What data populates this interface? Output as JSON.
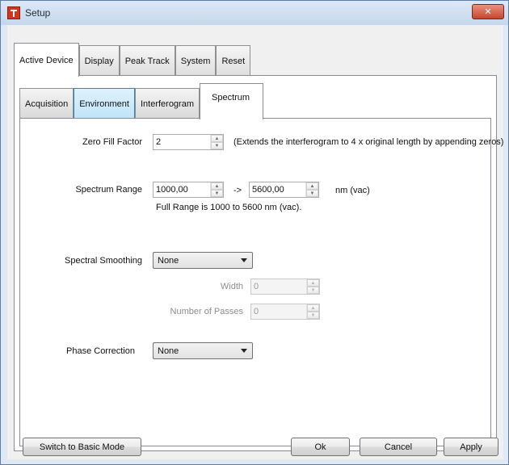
{
  "window": {
    "title": "Setup",
    "close_glyph": "✕"
  },
  "outer_tabs": [
    {
      "label": "Active Device",
      "active": true
    },
    {
      "label": "Display",
      "active": false
    },
    {
      "label": "Peak Track",
      "active": false
    },
    {
      "label": "System",
      "active": false
    },
    {
      "label": "Reset",
      "active": false
    }
  ],
  "inner_tabs": [
    {
      "label": "Acquisition",
      "active": false
    },
    {
      "label": "Environment",
      "active": false,
      "hover": true
    },
    {
      "label": "Interferogram",
      "active": false
    },
    {
      "label": "Spectrum",
      "active": true
    }
  ],
  "spectrum": {
    "zero_fill": {
      "label": "Zero Fill Factor",
      "value": "2",
      "note": "(Extends the interferogram to 4 x original length by appending zeros)"
    },
    "range": {
      "label": "Spectrum Range",
      "min": "1000,00",
      "arrow": "->",
      "max": "5600,00",
      "unit": "nm (vac)",
      "full_range_note": "Full Range is 1000 to 5600 nm (vac)."
    },
    "smoothing": {
      "label": "Spectral Smoothing",
      "selected": "None",
      "width_label": "Width",
      "width_value": "0",
      "passes_label": "Number of Passes",
      "passes_value": "0"
    },
    "phase": {
      "label": "Phase Correction",
      "selected": "None"
    }
  },
  "footer": {
    "basic_mode_label": "Switch to Basic Mode",
    "ok_label": "Ok",
    "cancel_label": "Cancel",
    "apply_label": "Apply"
  },
  "colors": {
    "title_close": "#c8452e",
    "app_icon": "#d4351c",
    "hover_tab": "#bfe4f8"
  },
  "icons": {
    "app": "setup-app-icon",
    "close": "close-icon",
    "spin_up": "spin-up-icon",
    "spin_down": "spin-down-icon",
    "dropdown": "chevron-down-icon"
  }
}
